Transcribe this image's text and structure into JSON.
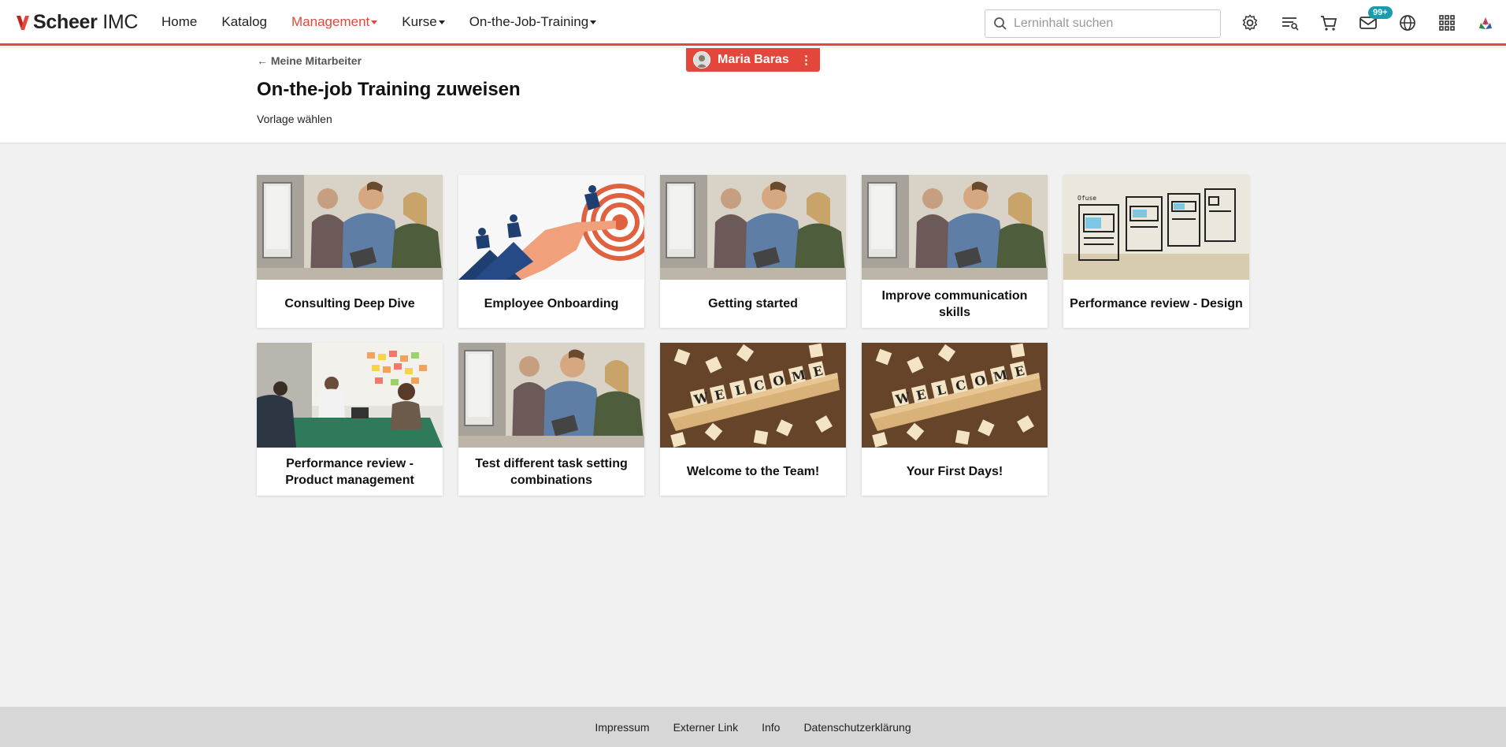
{
  "brand": {
    "name_bold": "Scheer",
    "name_light": "IMC",
    "accent": "#e3473c"
  },
  "nav": {
    "items": [
      {
        "label": "Home",
        "dropdown": false,
        "active": false
      },
      {
        "label": "Katalog",
        "dropdown": false,
        "active": false
      },
      {
        "label": "Management",
        "dropdown": true,
        "active": true
      },
      {
        "label": "Kurse",
        "dropdown": true,
        "active": false
      },
      {
        "label": "On-the-Job-Training",
        "dropdown": true,
        "active": false
      }
    ]
  },
  "search": {
    "placeholder": "Lerninhalt suchen",
    "value": ""
  },
  "toolbar": {
    "icons": [
      "gear-icon",
      "playlist-search-icon",
      "cart-icon",
      "mail-icon",
      "globe-icon",
      "apps-grid-icon",
      "app-logo-icon"
    ],
    "mail_badge": "99+",
    "badge_color": "#1a9bb0"
  },
  "header": {
    "back_label": "Meine Mitarbeiter",
    "title": "On-the-job Training zuweisen",
    "subtitle": "Vorlage wählen"
  },
  "user": {
    "name": "Maria Baras",
    "menu_icon": "more-vertical-icon"
  },
  "cards": [
    {
      "title": "Consulting Deep Dive",
      "image": "office-team"
    },
    {
      "title": "Employee Onboarding",
      "image": "target-hand"
    },
    {
      "title": "Getting started",
      "image": "office-team"
    },
    {
      "title": "Improve communication skills",
      "image": "office-team"
    },
    {
      "title": "Performance review - Design",
      "image": "wireframe-sketch"
    },
    {
      "title": "Performance review - Product management",
      "image": "meeting-room"
    },
    {
      "title": "Test different task setting combinations",
      "image": "office-team"
    },
    {
      "title": "Welcome to the Team!",
      "image": "welcome-tiles"
    },
    {
      "title": "Your First Days!",
      "image": "welcome-tiles"
    }
  ],
  "footer": {
    "links": [
      "Impressum",
      "Externer Link",
      "Info",
      "Datenschutzerklärung"
    ]
  },
  "welcome_word": [
    "W",
    "E",
    "L",
    "C",
    "O",
    "M",
    "E"
  ]
}
